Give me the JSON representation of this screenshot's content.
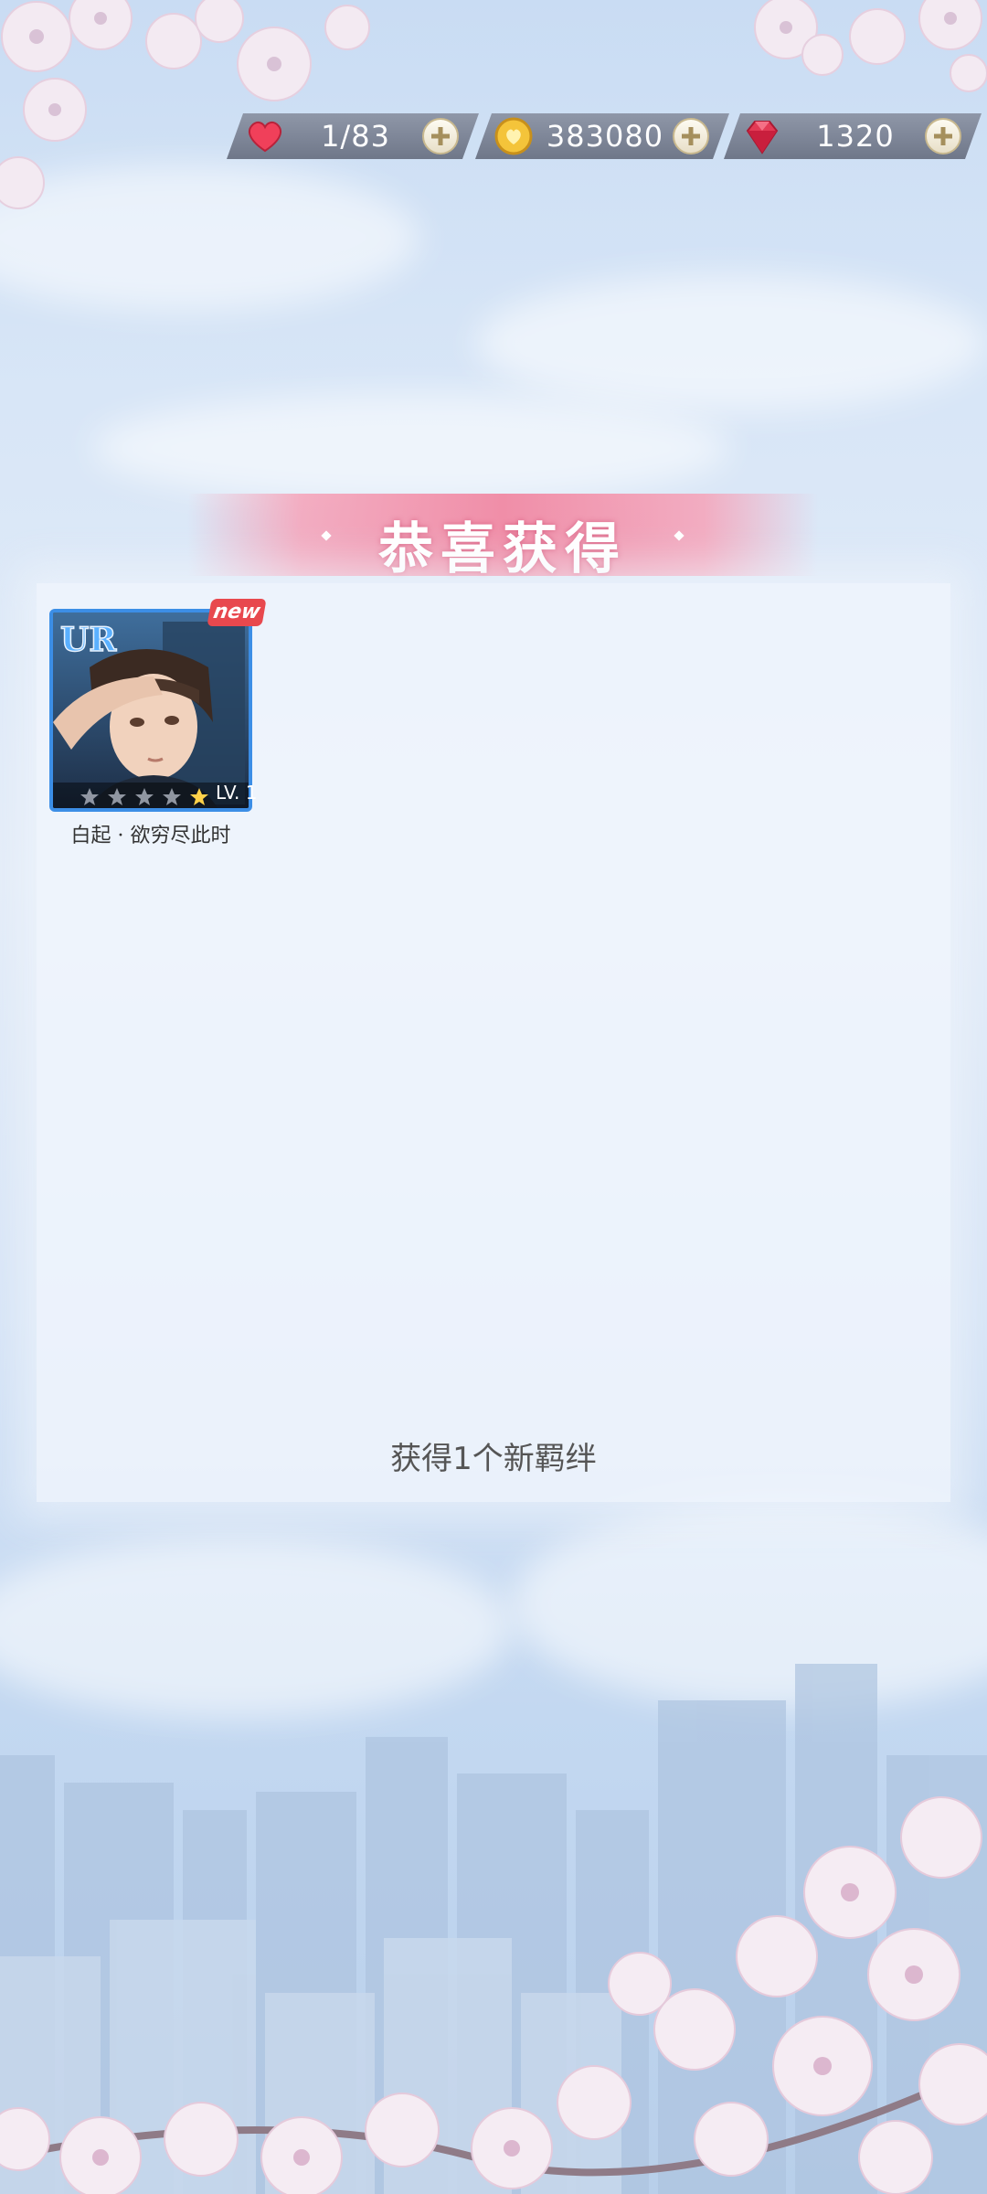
{
  "resources": [
    {
      "name": "stamina",
      "icon": "heart-icon",
      "value": "1/83"
    },
    {
      "name": "gold",
      "icon": "gold-coin-icon",
      "value": "383080"
    },
    {
      "name": "diamond",
      "icon": "diamond-icon",
      "value": "1320"
    }
  ],
  "banner": {
    "title": "恭喜获得"
  },
  "reward": {
    "rarity": "UR",
    "badge": "new",
    "level": "LV. 1",
    "name": "白起 · 欲穷尽此时"
  },
  "summary": "获得1个新羁绊",
  "colors": {
    "accent": "#f08ea8",
    "card_border": "#3c8ee6",
    "new_badge": "#e8484e"
  }
}
